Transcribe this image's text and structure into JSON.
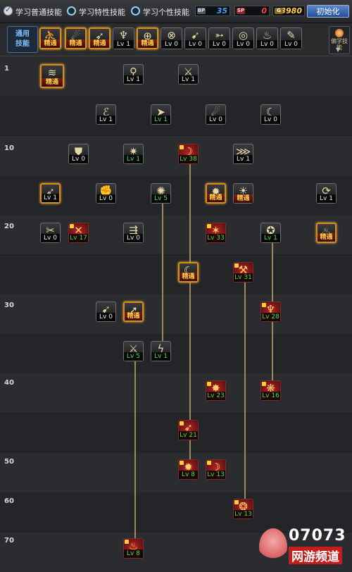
{
  "header": {
    "modes": [
      {
        "label": "学习普通技能",
        "state": "checked"
      },
      {
        "label": "学习特性技能",
        "state": "unchecked"
      },
      {
        "label": "学习个性技能",
        "state": "unchecked"
      }
    ],
    "counters": [
      {
        "icon_label": "BP",
        "value": "35",
        "color": "#3ea2ff"
      },
      {
        "icon_label": "SP",
        "value": "0",
        "color": "#ff4040"
      },
      {
        "icon_label": "G",
        "value": "3980",
        "color": "#ffd050"
      }
    ],
    "reset_label": "初始化"
  },
  "common_skills": {
    "label_line1": "通用",
    "label_line2": "技能",
    "side_label": "偏学技能",
    "items": [
      {
        "level": "精通",
        "mastered": true,
        "icon": "sit-icon",
        "glyph": "⛹"
      },
      {
        "level": "精通",
        "mastered": true,
        "icon": "leap-icon",
        "glyph": "☄"
      },
      {
        "level": "精通",
        "mastered": true,
        "icon": "run-icon",
        "glyph": "➶"
      },
      {
        "level": "Lv 1",
        "mastered": false,
        "icon": "wings-icon",
        "glyph": "♆"
      },
      {
        "level": "精通",
        "mastered": true,
        "icon": "target-icon",
        "glyph": "⊕"
      },
      {
        "level": "Lv 0",
        "mastered": false,
        "icon": "cross-target-icon",
        "glyph": "⊗"
      },
      {
        "level": "Lv 0",
        "mastered": false,
        "icon": "kick-icon",
        "glyph": "➹"
      },
      {
        "level": "Lv 0",
        "mastered": false,
        "icon": "dash-icon",
        "glyph": "➳"
      },
      {
        "level": "Lv 0",
        "mastered": false,
        "icon": "spiral-icon",
        "glyph": "◎"
      },
      {
        "level": "Lv 0",
        "mastered": false,
        "icon": "flex-icon",
        "glyph": "♨"
      },
      {
        "level": "Lv 0",
        "mastered": false,
        "icon": "book-icon",
        "glyph": "✎"
      }
    ]
  },
  "tree": {
    "levels": [
      "1",
      "10",
      "20",
      "30",
      "40",
      "50",
      "60",
      "70"
    ],
    "skills": [
      {
        "id": "s-wind-dash",
        "level": "精通",
        "style": "mastered",
        "lv_color": "gold",
        "icon": "wind-dash-icon",
        "glyph": "≋"
      },
      {
        "id": "s-dagger",
        "level": "Lv 1",
        "style": "normal",
        "lv_color": "white",
        "icon": "dagger-icon",
        "glyph": "⚲"
      },
      {
        "id": "s-sword-chain",
        "level": "Lv 1",
        "style": "normal",
        "lv_color": "white",
        "icon": "sword-chain-icon",
        "glyph": "⚔"
      },
      {
        "id": "s-footwork",
        "level": "Lv 1",
        "style": "normal",
        "lv_color": "white",
        "icon": "footwork-icon",
        "glyph": "ℰ"
      },
      {
        "id": "s-sprint",
        "level": "Lv 1",
        "style": "normal",
        "lv_color": "green",
        "icon": "sprint-icon",
        "glyph": "➤"
      },
      {
        "id": "s-fireball",
        "level": "Lv 0",
        "style": "normal",
        "lv_color": "white",
        "icon": "fireball-icon",
        "glyph": "☄"
      },
      {
        "id": "s-crescent",
        "level": "Lv 0",
        "style": "normal",
        "lv_color": "white",
        "icon": "crescent-icon",
        "glyph": "☾"
      },
      {
        "id": "s-shield",
        "level": "Lv 0",
        "style": "normal",
        "lv_color": "white",
        "icon": "shield-icon",
        "glyph": "⛊"
      },
      {
        "id": "s-blade-burst",
        "level": "Lv 1",
        "style": "normal",
        "lv_color": "green",
        "icon": "blade-burst-icon",
        "glyph": "✷"
      },
      {
        "id": "s-red-slash",
        "level": "Lv 38",
        "style": "red",
        "lv_color": "green",
        "icon": "red-slash-icon",
        "glyph": "☽"
      },
      {
        "id": "s-claws",
        "level": "Lv 1",
        "style": "normal",
        "lv_color": "white",
        "icon": "claws-icon",
        "glyph": "⋙"
      },
      {
        "id": "s-runner",
        "level": "Lv 1",
        "style": "mastered",
        "lv_color": "white",
        "icon": "runner-icon",
        "glyph": "➶"
      },
      {
        "id": "s-grab",
        "level": "Lv 0",
        "style": "normal",
        "lv_color": "white",
        "icon": "grab-icon",
        "glyph": "✊"
      },
      {
        "id": "s-whirl",
        "level": "Lv 5",
        "style": "normal",
        "lv_color": "green",
        "icon": "whirl-icon",
        "glyph": "✺"
      },
      {
        "id": "s-sun-burst",
        "level": "精通",
        "style": "mastered",
        "lv_color": "gold",
        "icon": "sun-burst-icon",
        "glyph": "✹"
      },
      {
        "id": "s-aura",
        "level": "精通",
        "style": "normal",
        "lv_color": "gold",
        "icon": "aura-icon",
        "glyph": "☀"
      },
      {
        "id": "s-spin-kick",
        "level": "Lv 1",
        "style": "normal",
        "lv_color": "white",
        "icon": "spin-kick-icon",
        "glyph": "⟳"
      },
      {
        "id": "s-cross-blades",
        "level": "Lv 0",
        "style": "normal",
        "lv_color": "white",
        "icon": "cross-blades-icon",
        "glyph": "✂"
      },
      {
        "id": "s-twin-sword",
        "level": "Lv 17",
        "style": "red",
        "lv_color": "green",
        "icon": "twin-sword-icon",
        "glyph": "✕"
      },
      {
        "id": "s-slide",
        "level": "Lv 0",
        "style": "normal",
        "lv_color": "white",
        "icon": "slide-icon",
        "glyph": "⇶"
      },
      {
        "id": "s-meteor",
        "level": "Lv 33",
        "style": "red",
        "lv_color": "green",
        "icon": "meteor-icon",
        "glyph": "✶"
      },
      {
        "id": "s-vortex",
        "level": "Lv 1",
        "style": "normal",
        "lv_color": "green",
        "icon": "vortex-icon",
        "glyph": "✪"
      },
      {
        "id": "s-fire-swirl",
        "level": "精通",
        "style": "mastered",
        "lv_color": "gold",
        "icon": "fire-swirl-icon",
        "glyph": "♨"
      },
      {
        "id": "s-moon-slash",
        "level": "精通",
        "style": "mastered",
        "lv_color": "gold",
        "icon": "moon-slash-icon",
        "glyph": "☾"
      },
      {
        "id": "s-hammer",
        "level": "Lv 31",
        "style": "red",
        "lv_color": "green",
        "icon": "hammer-icon",
        "glyph": "⚒"
      },
      {
        "id": "s-charge",
        "level": "Lv 0",
        "style": "normal",
        "lv_color": "white",
        "icon": "charge-icon",
        "glyph": "➹"
      },
      {
        "id": "s-leap-strike",
        "level": "精通",
        "style": "mastered",
        "lv_color": "gold",
        "icon": "leap-strike-icon",
        "glyph": "➚"
      },
      {
        "id": "s-flame-lamp",
        "level": "Lv 28",
        "style": "red",
        "lv_color": "green",
        "icon": "flame-lamp-icon",
        "glyph": "♆"
      },
      {
        "id": "s-double-edge",
        "level": "Lv 5",
        "style": "normal",
        "lv_color": "green",
        "icon": "double-edge-icon",
        "glyph": "⚔"
      },
      {
        "id": "s-lightning",
        "level": "Lv 1",
        "style": "normal",
        "lv_color": "green",
        "icon": "lightning-icon",
        "glyph": "ϟ"
      },
      {
        "id": "s-explosion",
        "level": "Lv 23",
        "style": "red",
        "lv_color": "green",
        "icon": "explosion-icon",
        "glyph": "✸"
      },
      {
        "id": "s-blades-fan",
        "level": "Lv 16",
        "style": "red",
        "lv_color": "green",
        "icon": "blades-fan-icon",
        "glyph": "❋"
      },
      {
        "id": "s-upper-slash",
        "level": "Lv 21",
        "style": "red",
        "lv_color": "green",
        "icon": "upper-slash-icon",
        "glyph": "➶"
      },
      {
        "id": "s-flame-burst",
        "level": "Lv 8",
        "style": "red",
        "lv_color": "green",
        "icon": "flame-burst-icon",
        "glyph": "✹"
      },
      {
        "id": "s-crescent-red",
        "level": "Lv 13",
        "style": "red",
        "lv_color": "green",
        "icon": "crescent-red-icon",
        "glyph": "☽"
      },
      {
        "id": "s-fire-wheel",
        "level": "Lv 13",
        "style": "red",
        "lv_color": "green",
        "icon": "fire-wheel-icon",
        "glyph": "❂"
      },
      {
        "id": "s-inferno",
        "level": "Lv 8",
        "style": "red",
        "lv_color": "green",
        "icon": "inferno-icon",
        "glyph": "♨"
      }
    ]
  },
  "watermark": {
    "number": "07073",
    "text": "网游频道"
  }
}
